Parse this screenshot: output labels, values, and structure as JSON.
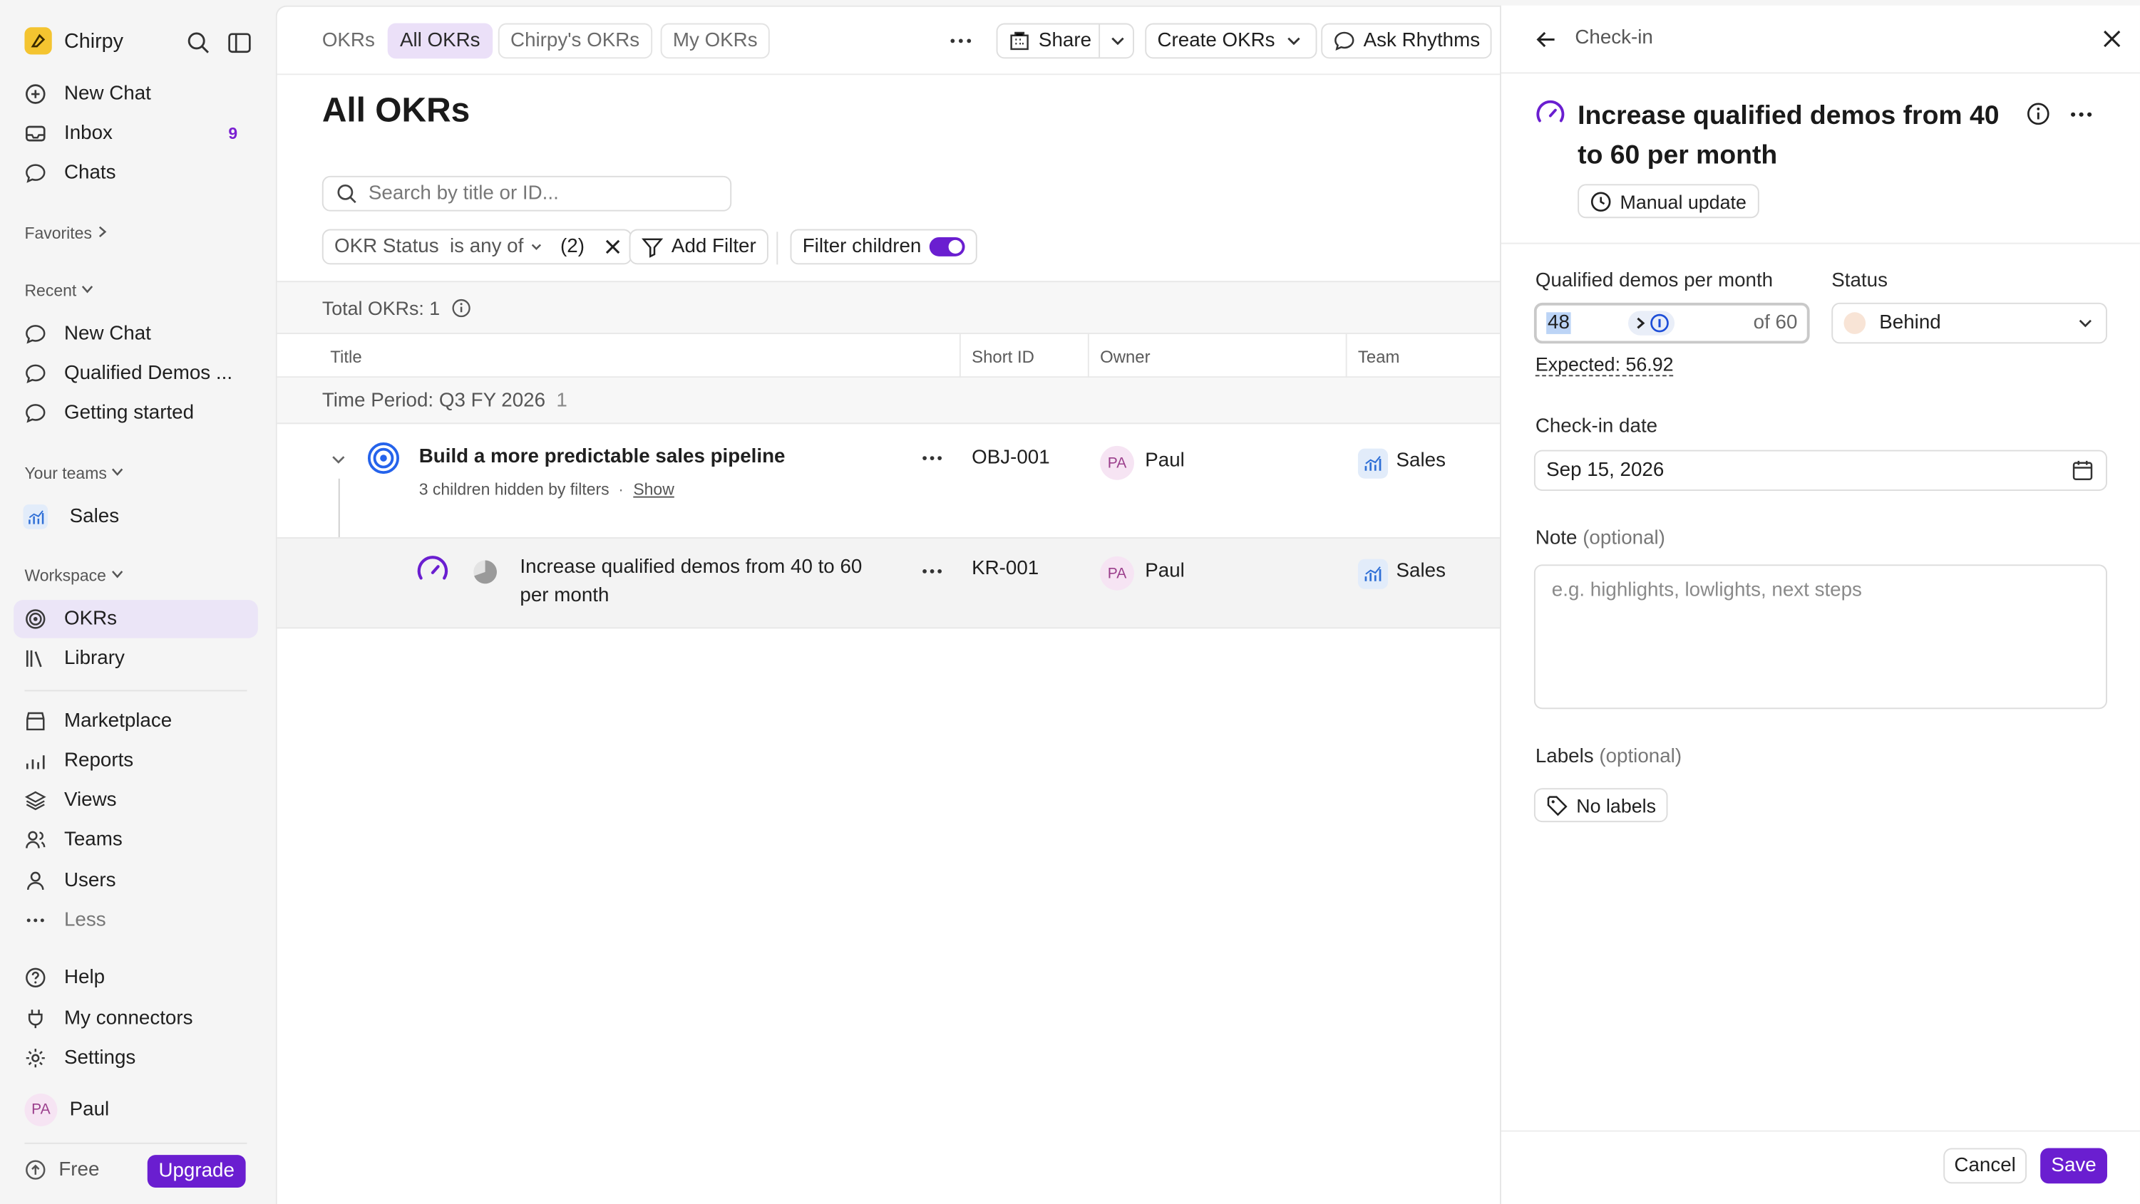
{
  "sidebar": {
    "workspace_name": "Chirpy",
    "nav": [
      {
        "label": "New Chat",
        "icon": "new-chat-icon"
      },
      {
        "label": "Inbox",
        "icon": "inbox-icon",
        "badge": "9"
      },
      {
        "label": "Chats",
        "icon": "chat-bubble-icon"
      }
    ],
    "favorites_label": "Favorites",
    "recent_label": "Recent",
    "recent": [
      {
        "label": "New Chat"
      },
      {
        "label": "Qualified Demos ..."
      },
      {
        "label": "Getting started"
      }
    ],
    "your_teams_label": "Your teams",
    "teams": [
      {
        "label": "Sales",
        "icon": "chart-icon"
      }
    ],
    "workspace_label": "Workspace",
    "workspace_items": [
      {
        "label": "OKRs",
        "icon": "target-icon",
        "active": true
      },
      {
        "label": "Library",
        "icon": "library-icon"
      }
    ],
    "more_items": [
      {
        "label": "Marketplace",
        "icon": "marketplace-icon"
      },
      {
        "label": "Reports",
        "icon": "reports-icon"
      },
      {
        "label": "Views",
        "icon": "layers-icon"
      },
      {
        "label": "Teams",
        "icon": "teams-icon"
      },
      {
        "label": "Users",
        "icon": "user-icon"
      },
      {
        "label": "Less",
        "icon": "more-icon"
      }
    ],
    "bottom_items": [
      {
        "label": "Help",
        "icon": "help-icon"
      },
      {
        "label": "My connectors",
        "icon": "plug-icon"
      },
      {
        "label": "Settings",
        "icon": "gear-icon"
      }
    ],
    "user": {
      "initials": "PA",
      "name": "Paul"
    },
    "plan_label": "Free",
    "upgrade_label": "Upgrade"
  },
  "header": {
    "tabs": [
      {
        "label": "OKRs"
      },
      {
        "label": "All OKRs",
        "active": true
      },
      {
        "label": "Chirpy's OKRs"
      },
      {
        "label": "My OKRs"
      }
    ],
    "share_label": "Share",
    "create_label": "Create OKRs",
    "ask_label": "Ask Rhythms"
  },
  "main": {
    "title": "All OKRs",
    "search_placeholder": "Search by title or ID...",
    "filter": {
      "field": "OKR Status",
      "operator": "is any of",
      "count": "(2)"
    },
    "add_filter_label": "Add Filter",
    "filter_children_label": "Filter children",
    "total_label": "Total OKRs: 1",
    "columns": [
      "Title",
      "Short ID",
      "Owner",
      "Team"
    ],
    "period": {
      "label": "Time Period: Q3 FY 2026",
      "count": "1"
    },
    "rows": [
      {
        "title": "Build a more predictable sales pipeline",
        "sub": "3 children hidden by filters",
        "sub_link": "Show",
        "id": "OBJ-001",
        "owner_initials": "PA",
        "owner": "Paul",
        "team": "Sales"
      },
      {
        "title_line1": "Increase qualified demos from 40 to 60",
        "title_line2": "per month",
        "id": "KR-001",
        "owner_initials": "PA",
        "owner": "Paul",
        "team": "Sales"
      }
    ]
  },
  "panel": {
    "header_label": "Check-in",
    "title_line1": "Increase qualified demos from 40",
    "title_line2": "to 60 per month",
    "update_type": "Manual update",
    "metric_label": "Qualified demos per month",
    "metric_value": "48",
    "metric_target": "of 60",
    "expected": "Expected: 56.92",
    "status_label": "Status",
    "status_value": "Behind",
    "date_label": "Check-in date",
    "date_value": "Sep 15, 2026",
    "note_label": "Note",
    "note_optional": "(optional)",
    "note_placeholder": "e.g. highlights, lowlights, next steps",
    "labels_label": "Labels",
    "labels_optional": "(optional)",
    "no_labels": "No labels",
    "cancel_label": "Cancel",
    "save_label": "Save"
  },
  "colors": {
    "accent": "#6a1ed0",
    "active_nav": "#ebe5f7",
    "status_behind": "#f8e4d6"
  }
}
